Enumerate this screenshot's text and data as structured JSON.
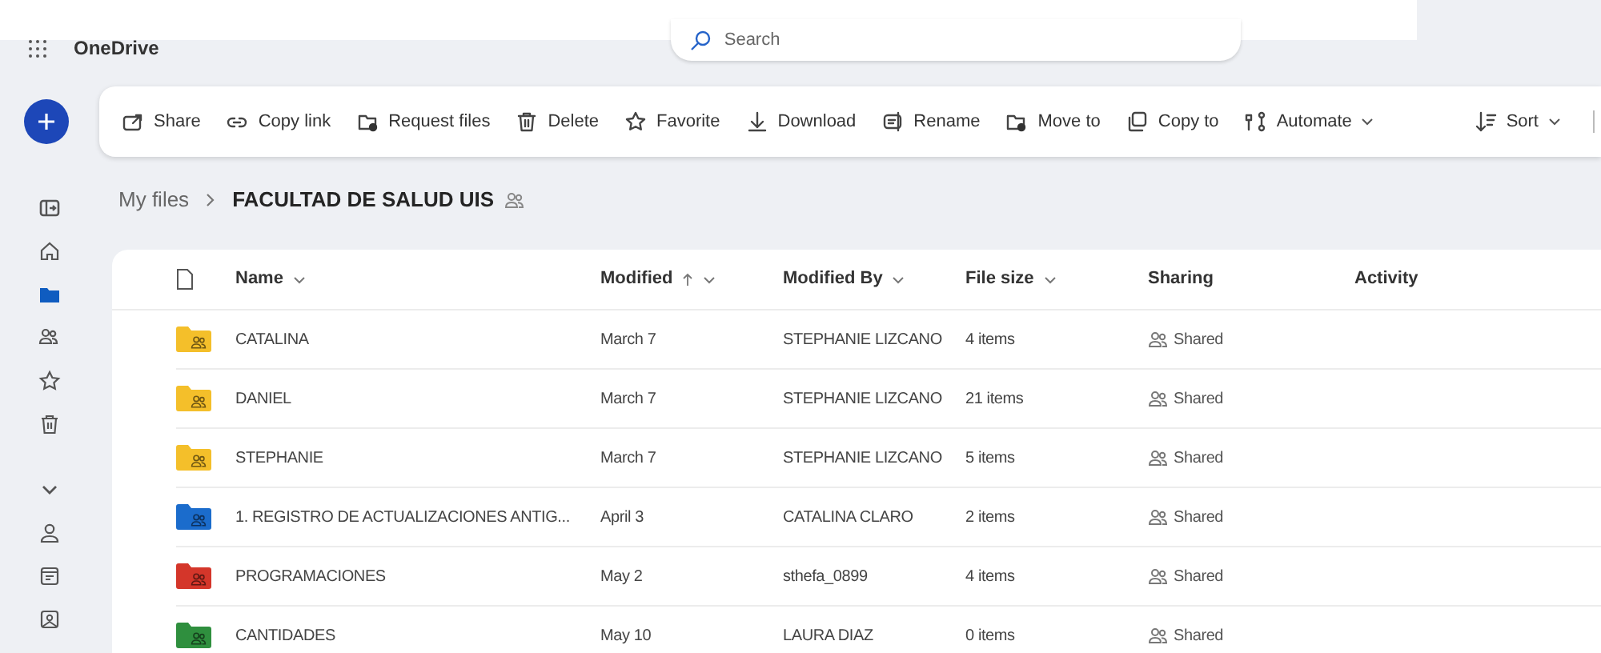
{
  "app": {
    "title": "OneDrive"
  },
  "search": {
    "placeholder": "Search"
  },
  "toolbar": [
    {
      "kind": "share",
      "label": "Share",
      "dropdown": false
    },
    {
      "kind": "link",
      "label": "Copy link",
      "dropdown": false
    },
    {
      "kind": "request",
      "label": "Request files",
      "dropdown": false
    },
    {
      "kind": "delete",
      "label": "Delete",
      "dropdown": false
    },
    {
      "kind": "favorite",
      "label": "Favorite",
      "dropdown": false
    },
    {
      "kind": "download",
      "label": "Download",
      "dropdown": false
    },
    {
      "kind": "rename",
      "label": "Rename",
      "dropdown": false
    },
    {
      "kind": "move",
      "label": "Move to",
      "dropdown": false
    },
    {
      "kind": "copy",
      "label": "Copy to",
      "dropdown": false
    },
    {
      "kind": "automate",
      "label": "Automate",
      "dropdown": true
    }
  ],
  "sort_button": {
    "label": "Sort",
    "dropdown": true
  },
  "sidebar": {
    "items": [
      {
        "kind": "panel",
        "selected": false
      },
      {
        "kind": "home",
        "selected": false
      },
      {
        "kind": "folder",
        "selected": true
      },
      {
        "kind": "people",
        "selected": false
      },
      {
        "kind": "star",
        "selected": false
      },
      {
        "kind": "trash",
        "selected": false
      },
      {
        "kind": "chevron",
        "selected": false
      },
      {
        "kind": "person",
        "selected": false
      },
      {
        "kind": "calendar",
        "selected": false
      },
      {
        "kind": "photo",
        "selected": false
      }
    ]
  },
  "breadcrumb": [
    {
      "label": "My files",
      "current": false
    },
    {
      "label": "FACULTAD DE SALUD UIS",
      "current": true,
      "shared": true
    }
  ],
  "table": {
    "columns": [
      {
        "label": "Name",
        "sorted": false,
        "dropdown": true
      },
      {
        "label": "Modified",
        "sorted": true,
        "dropdown": true
      },
      {
        "label": "Modified By",
        "sorted": false,
        "dropdown": true
      },
      {
        "label": "File size",
        "sorted": false,
        "dropdown": true
      },
      {
        "label": "Sharing",
        "sorted": false,
        "dropdown": false
      },
      {
        "label": "Activity",
        "sorted": false,
        "dropdown": false
      }
    ],
    "rows": [
      {
        "name": "CATALINA",
        "color": "#f4bf2a",
        "modified": "March 7",
        "modified_by": "STEPHANIE LIZCANO",
        "size": "4 items",
        "sharing": "Shared"
      },
      {
        "name": "DANIEL",
        "color": "#f4bf2a",
        "modified": "March 7",
        "modified_by": "STEPHANIE LIZCANO",
        "size": "21 items",
        "sharing": "Shared"
      },
      {
        "name": "STEPHANIE",
        "color": "#f4bf2a",
        "modified": "March 7",
        "modified_by": "STEPHANIE LIZCANO",
        "size": "5 items",
        "sharing": "Shared"
      },
      {
        "name": "1. REGISTRO DE ACTUALIZACIONES ANTIG...",
        "color": "#1b6ccc",
        "modified": "April 3",
        "modified_by": "CATALINA CLARO",
        "size": "2 items",
        "sharing": "Shared"
      },
      {
        "name": "PROGRAMACIONES",
        "color": "#d4362a",
        "modified": "May 2",
        "modified_by": "sthefa_0899",
        "size": "4 items",
        "sharing": "Shared"
      },
      {
        "name": "CANTIDADES",
        "color": "#2f8f3e",
        "modified": "May 10",
        "modified_by": "LAURA DIAZ",
        "size": "0 items",
        "sharing": "Shared"
      }
    ]
  }
}
